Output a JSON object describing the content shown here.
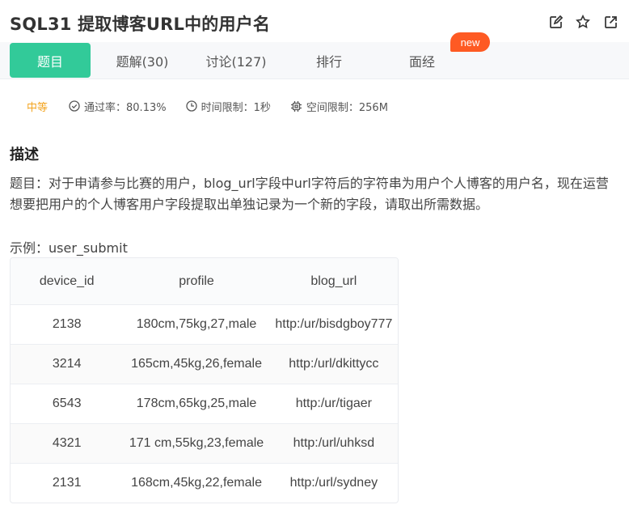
{
  "header": {
    "title": "SQL31  提取博客URL中的用户名",
    "icons": [
      "edit-icon",
      "star-icon",
      "share-icon",
      "help-icon"
    ]
  },
  "tabs": [
    {
      "label": "题目",
      "active": true
    },
    {
      "label": "题解(30)"
    },
    {
      "label": "讨论(127)"
    },
    {
      "label": "排行"
    },
    {
      "label": "面经"
    }
  ],
  "new_badge": "new",
  "meta": {
    "difficulty": "中等",
    "pass_rate": "通过率：80.13%",
    "time_limit": "时间限制：1秒",
    "space_limit": "空间限制：256M"
  },
  "section": {
    "heading": "描述",
    "description": "题目：对于申请参与比赛的用户，blog_url字段中url字符后的字符串为用户个人博客的用户名，现在运营想要把用户的个人博客用户字段提取出单独记录为一个新的字段，请取出所需数据。",
    "example_label": "示例：user_submit"
  },
  "table": {
    "columns": [
      "device_id",
      "profile",
      "blog_url"
    ],
    "rows": [
      [
        "2138",
        "180cm,75kg,27,male",
        "http:/ur/bisdgboy777"
      ],
      [
        "3214",
        "165cm,45kg,26,female",
        "http:/url/dkittycc"
      ],
      [
        "6543",
        "178cm,65kg,25,male",
        "http:/ur/tigaer"
      ],
      [
        "4321",
        "171 cm,55kg,23,female",
        "http:/url/uhksd"
      ],
      [
        "2131",
        "168cm,45kg,22,female",
        "http:/url/sydney"
      ]
    ]
  },
  "colors": {
    "accent": "#32ca99",
    "new_badge": "#fe5a23",
    "difficulty": "#f3a41f"
  }
}
